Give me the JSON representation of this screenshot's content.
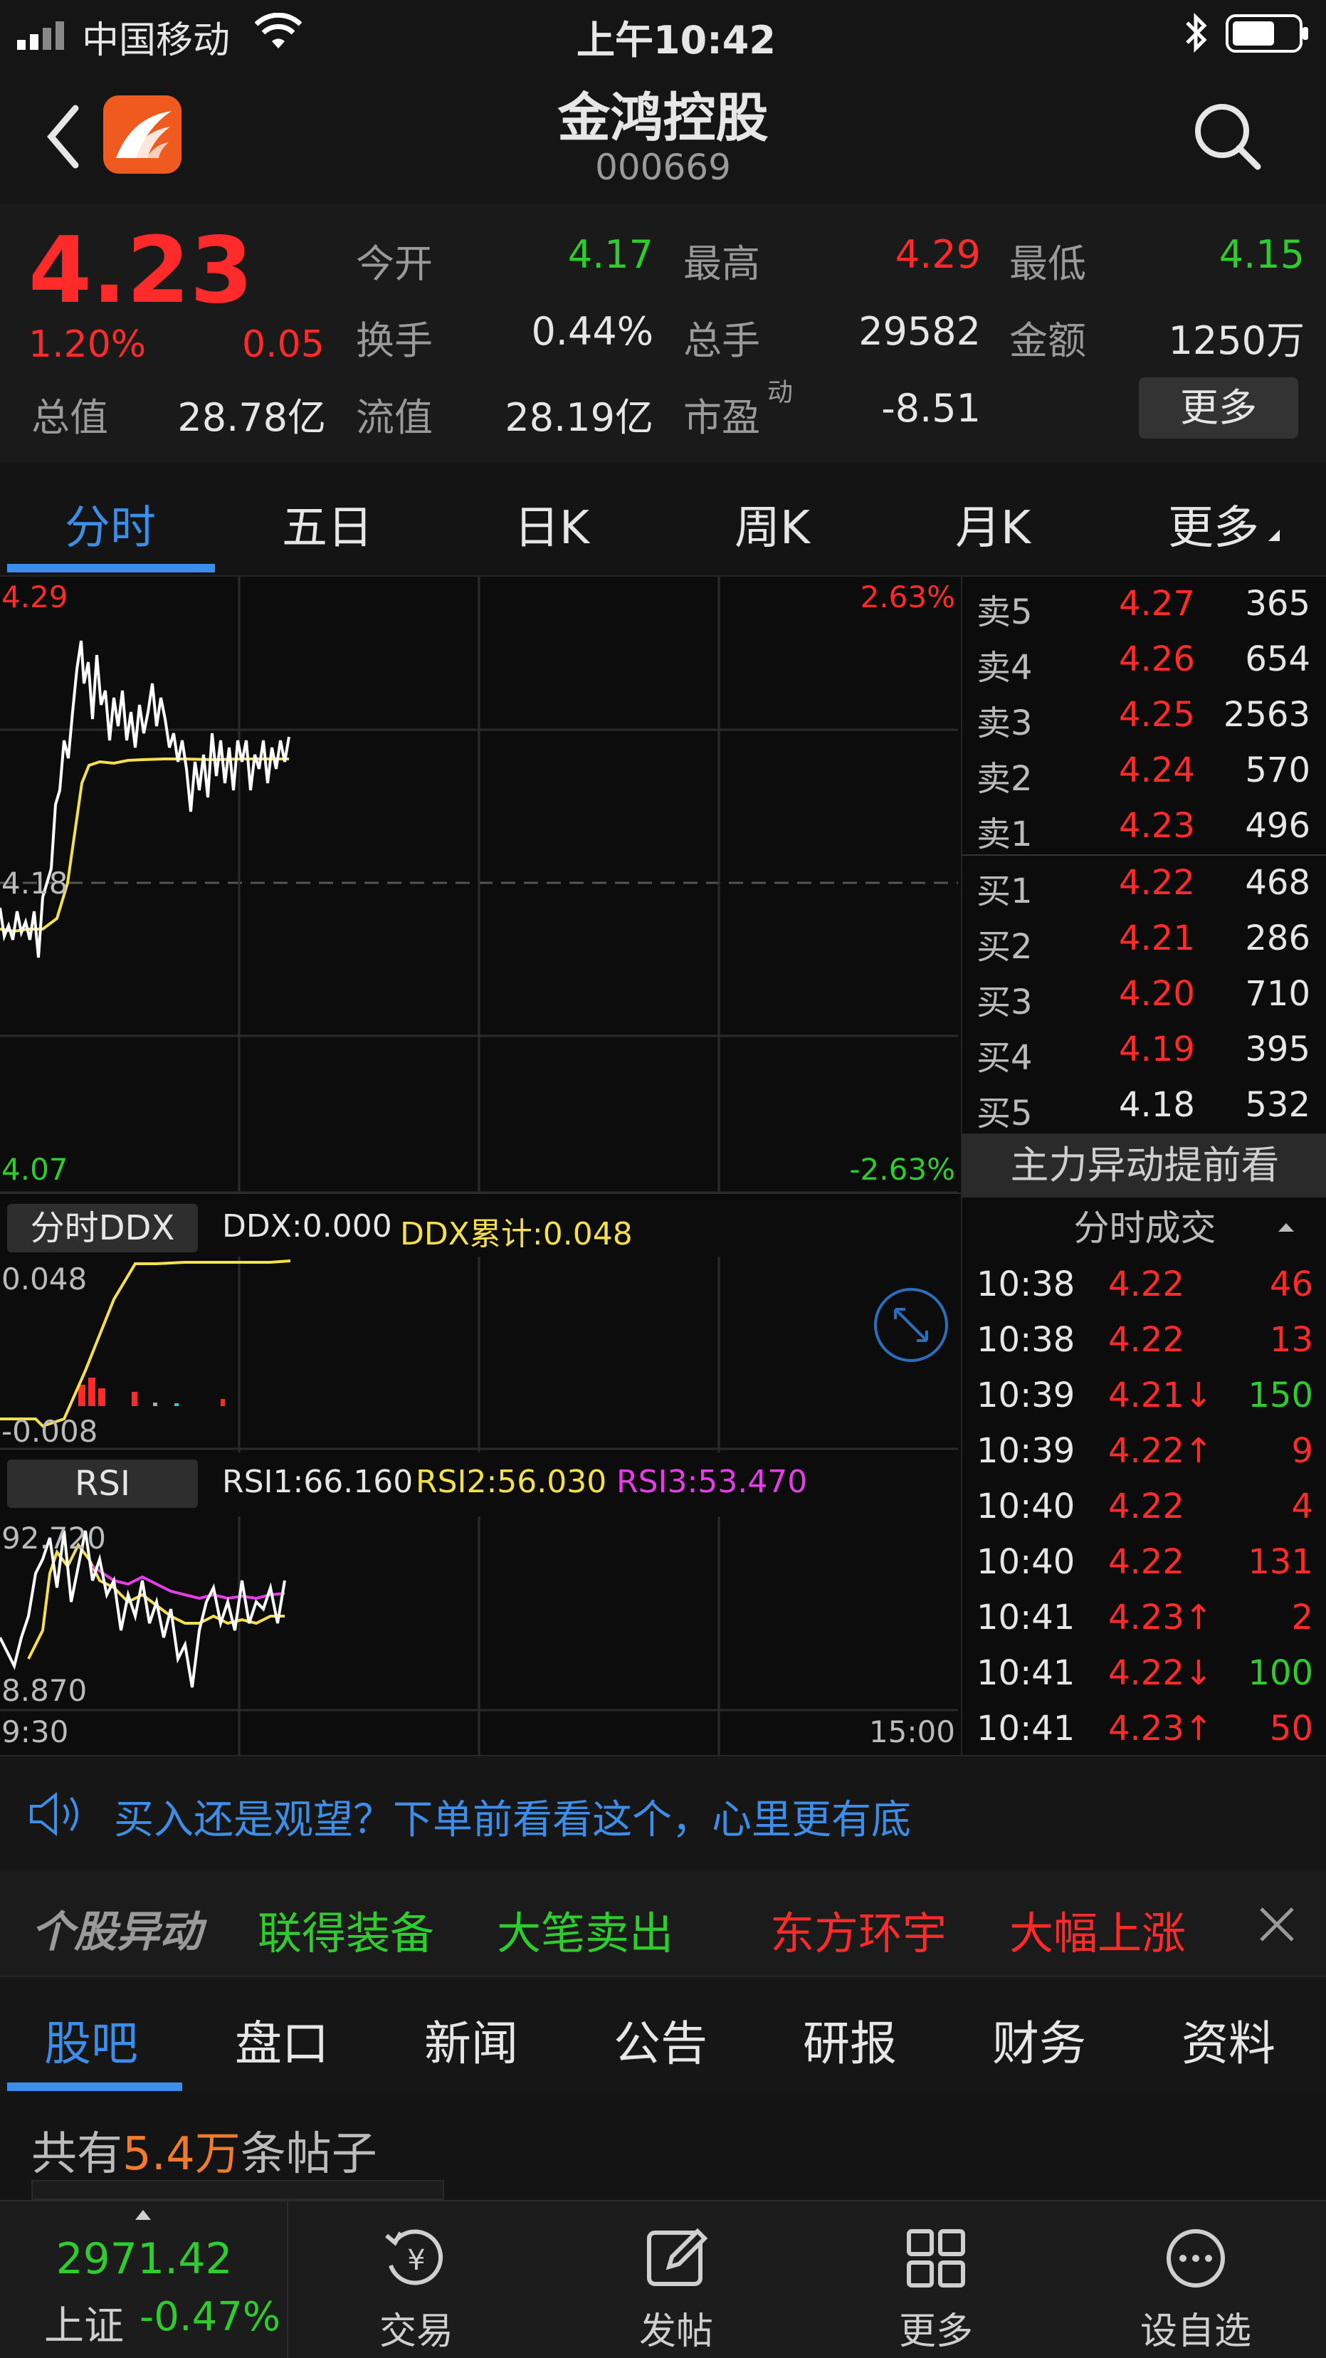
{
  "status": {
    "carrier": "中国移动",
    "time": "上午10:42"
  },
  "header": {
    "name": "金鸿控股",
    "code": "000669"
  },
  "quote": {
    "price": "4.23",
    "change_pct": "1.20%",
    "change": "0.05",
    "open_label": "今开",
    "open": "4.17",
    "high_label": "最高",
    "high": "4.29",
    "low_label": "最低",
    "low": "4.15",
    "turnover_label": "换手",
    "turnover": "0.44%",
    "volume_label": "总手",
    "volume": "29582",
    "amount_label": "金额",
    "amount": "1250万",
    "cap_label": "总值",
    "cap": "28.78亿",
    "float_label": "流值",
    "float": "28.19亿",
    "pe_label": "市盈",
    "pe_sup": "动",
    "pe": "-8.51",
    "more": "更多"
  },
  "tabs": [
    "分时",
    "五日",
    "日K",
    "周K",
    "月K",
    "更多"
  ],
  "chart": {
    "y_high": "4.29",
    "y_mid": "4.18",
    "y_low": "4.07",
    "pct_high": "2.63%",
    "pct_low": "-2.63%",
    "ddx_title": "分时DDX",
    "ddx": "DDX:0.000",
    "ddx_sum": "DDX累计:0.048",
    "ddx_top": "0.048",
    "ddx_bottom": "-0.008",
    "rsi_title": "RSI",
    "rsi1": "RSI1:66.160",
    "rsi2": "RSI2:56.030",
    "rsi3": "RSI3:53.470",
    "rsi_top": "92.720",
    "rsi_bottom": "8.870",
    "time_start": "9:30",
    "time_end": "15:00",
    "colors": {
      "price_line": "#ffffff",
      "avg_line": "#f4e04d",
      "rsi3": "#e43ee4"
    }
  },
  "orderbook": {
    "asks": [
      {
        "label": "卖5",
        "price": "4.27",
        "vol": "365"
      },
      {
        "label": "卖4",
        "price": "4.26",
        "vol": "654"
      },
      {
        "label": "卖3",
        "price": "4.25",
        "vol": "2563"
      },
      {
        "label": "卖2",
        "price": "4.24",
        "vol": "570"
      },
      {
        "label": "卖1",
        "price": "4.23",
        "vol": "496"
      }
    ],
    "bids": [
      {
        "label": "买1",
        "price": "4.22",
        "vol": "468"
      },
      {
        "label": "买2",
        "price": "4.21",
        "vol": "286"
      },
      {
        "label": "买3",
        "price": "4.20",
        "vol": "710"
      },
      {
        "label": "买4",
        "price": "4.19",
        "vol": "395"
      },
      {
        "label": "买5",
        "price": "4.18",
        "vol": "532"
      }
    ],
    "promo": "主力异动提前看",
    "trades_title": "分时成交",
    "trades": [
      {
        "time": "10:38",
        "price": "4.22",
        "vol": "46",
        "dir": ""
      },
      {
        "time": "10:38",
        "price": "4.22",
        "vol": "13",
        "dir": ""
      },
      {
        "time": "10:39",
        "price": "4.21↓",
        "vol": "150",
        "dir": "down"
      },
      {
        "time": "10:39",
        "price": "4.22↑",
        "vol": "9",
        "dir": "up"
      },
      {
        "time": "10:40",
        "price": "4.22",
        "vol": "4",
        "dir": ""
      },
      {
        "time": "10:40",
        "price": "4.22",
        "vol": "131",
        "dir": ""
      },
      {
        "time": "10:41",
        "price": "4.23↑",
        "vol": "2",
        "dir": "up"
      },
      {
        "time": "10:41",
        "price": "4.22↓",
        "vol": "100",
        "dir": "down"
      },
      {
        "time": "10:41",
        "price": "4.23↑",
        "vol": "50",
        "dir": "up"
      }
    ]
  },
  "notice": "买入还是观望？下单前看看这个，心里更有底",
  "ticker": {
    "title": "个股异动",
    "item1_name": "联得装备",
    "item1_event": "大笔卖出",
    "item2_name": "东方环宇",
    "item2_event": "大幅上涨"
  },
  "bottom_tabs": [
    "股吧",
    "盘口",
    "新闻",
    "公告",
    "研报",
    "财务",
    "资料"
  ],
  "posts": {
    "prefix": "共有",
    "count": "5.4万",
    "suffix": "条帖子"
  },
  "tabbar": {
    "index_value": "2971.42",
    "index_name": "上证",
    "index_pct": "-0.47%",
    "trade": "交易",
    "post": "发帖",
    "more": "更多",
    "watch": "设自选"
  }
}
